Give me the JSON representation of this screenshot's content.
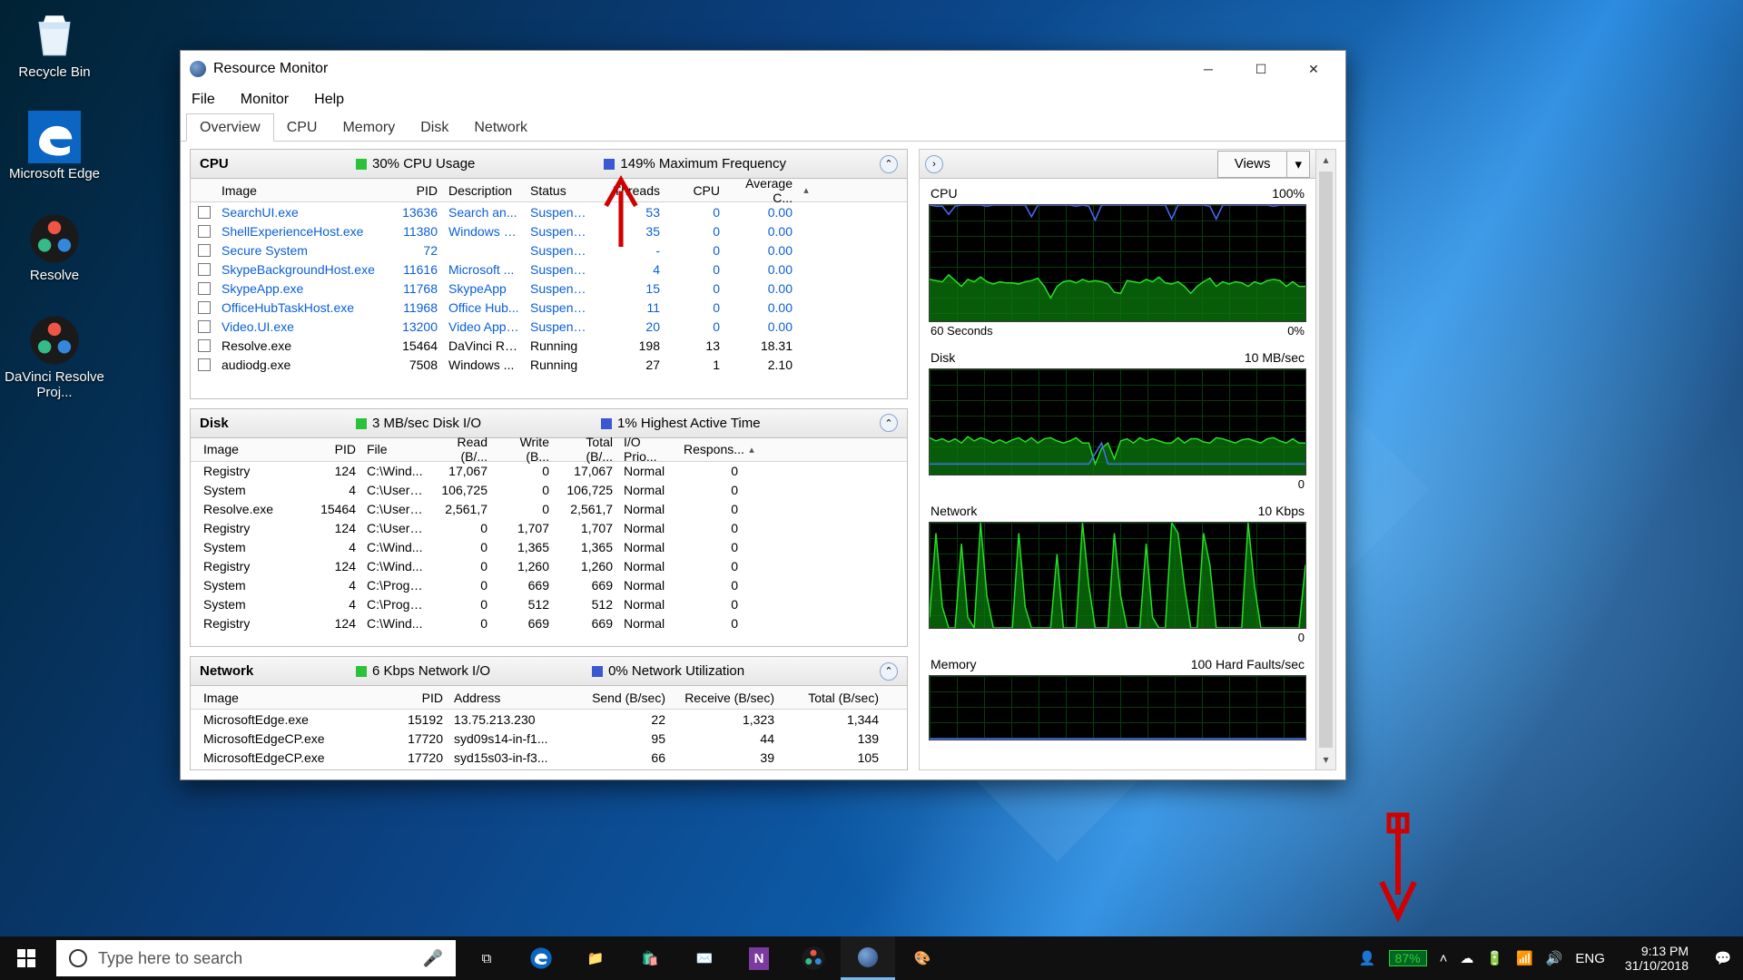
{
  "desktop": {
    "icons": [
      {
        "label": "Recycle Bin",
        "glyph": "recycle"
      },
      {
        "label": "Microsoft Edge",
        "glyph": "edge"
      },
      {
        "label": "Resolve",
        "glyph": "resolve"
      },
      {
        "label": "DaVinci Resolve Proj...",
        "glyph": "resolve"
      }
    ]
  },
  "window": {
    "title": "Resource Monitor",
    "menus": [
      "File",
      "Monitor",
      "Help"
    ],
    "tabs": [
      "Overview",
      "CPU",
      "Memory",
      "Disk",
      "Network"
    ],
    "active_tab": "Overview"
  },
  "cpu_panel": {
    "title": "CPU",
    "stat1": "30% CPU Usage",
    "stat2": "149% Maximum Frequency",
    "cols": [
      "Image",
      "PID",
      "Description",
      "Status",
      "Threads",
      "CPU",
      "Average C..."
    ],
    "rows": [
      {
        "img": "SearchUI.exe",
        "pid": "13636",
        "desc": "Search an...",
        "stat": "Suspended",
        "thr": "53",
        "cpu": "0",
        "avg": "0.00",
        "sus": true
      },
      {
        "img": "ShellExperienceHost.exe",
        "pid": "11380",
        "desc": "Windows S...",
        "stat": "Suspended",
        "thr": "35",
        "cpu": "0",
        "avg": "0.00",
        "sus": true
      },
      {
        "img": "Secure System",
        "pid": "72",
        "desc": "",
        "stat": "Suspended",
        "thr": "-",
        "cpu": "0",
        "avg": "0.00",
        "sus": true
      },
      {
        "img": "SkypeBackgroundHost.exe",
        "pid": "11616",
        "desc": "Microsoft ...",
        "stat": "Suspended",
        "thr": "4",
        "cpu": "0",
        "avg": "0.00",
        "sus": true
      },
      {
        "img": "SkypeApp.exe",
        "pid": "11768",
        "desc": "SkypeApp",
        "stat": "Suspended",
        "thr": "15",
        "cpu": "0",
        "avg": "0.00",
        "sus": true
      },
      {
        "img": "OfficeHubTaskHost.exe",
        "pid": "11968",
        "desc": "Office Hub...",
        "stat": "Suspended",
        "thr": "11",
        "cpu": "0",
        "avg": "0.00",
        "sus": true
      },
      {
        "img": "Video.UI.exe",
        "pid": "13200",
        "desc": "Video Appl...",
        "stat": "Suspended",
        "thr": "20",
        "cpu": "0",
        "avg": "0.00",
        "sus": true
      },
      {
        "img": "Resolve.exe",
        "pid": "15464",
        "desc": "DaVinci Re...",
        "stat": "Running",
        "thr": "198",
        "cpu": "13",
        "avg": "18.31",
        "sus": false
      },
      {
        "img": "audiodg.exe",
        "pid": "7508",
        "desc": "Windows ...",
        "stat": "Running",
        "thr": "27",
        "cpu": "1",
        "avg": "2.10",
        "sus": false
      }
    ]
  },
  "disk_panel": {
    "title": "Disk",
    "stat1": "3 MB/sec Disk I/O",
    "stat2": "1% Highest Active Time",
    "cols": [
      "Image",
      "PID",
      "File",
      "Read (B/...",
      "Write (B...",
      "Total (B/...",
      "I/O Prio...",
      "Respons..."
    ],
    "rows": [
      {
        "img": "Registry",
        "pid": "124",
        "file": "C:\\Wind...",
        "r": "17,067",
        "w": "0",
        "t": "17,067",
        "io": "Normal",
        "resp": "0"
      },
      {
        "img": "System",
        "pid": "4",
        "file": "C:\\Users...",
        "r": "106,725",
        "w": "0",
        "t": "106,725",
        "io": "Normal",
        "resp": "0"
      },
      {
        "img": "Resolve.exe",
        "pid": "15464",
        "file": "C:\\Users...",
        "r": "2,561,7",
        "w": "0",
        "t": "2,561,7",
        "io": "Normal",
        "resp": "0"
      },
      {
        "img": "Registry",
        "pid": "124",
        "file": "C:\\Users...",
        "r": "0",
        "w": "1,707",
        "t": "1,707",
        "io": "Normal",
        "resp": "0"
      },
      {
        "img": "System",
        "pid": "4",
        "file": "C:\\Wind...",
        "r": "0",
        "w": "1,365",
        "t": "1,365",
        "io": "Normal",
        "resp": "0"
      },
      {
        "img": "Registry",
        "pid": "124",
        "file": "C:\\Wind...",
        "r": "0",
        "w": "1,260",
        "t": "1,260",
        "io": "Normal",
        "resp": "0"
      },
      {
        "img": "System",
        "pid": "4",
        "file": "C:\\Progr...",
        "r": "0",
        "w": "669",
        "t": "669",
        "io": "Normal",
        "resp": "0"
      },
      {
        "img": "System",
        "pid": "4",
        "file": "C:\\Progr...",
        "r": "0",
        "w": "512",
        "t": "512",
        "io": "Normal",
        "resp": "0"
      },
      {
        "img": "Registry",
        "pid": "124",
        "file": "C:\\Wind...",
        "r": "0",
        "w": "669",
        "t": "669",
        "io": "Normal",
        "resp": "0"
      }
    ]
  },
  "net_panel": {
    "title": "Network",
    "stat1": "6 Kbps Network I/O",
    "stat2": "0% Network Utilization",
    "cols": [
      "Image",
      "PID",
      "Address",
      "Send (B/sec)",
      "Receive (B/sec)",
      "Total (B/sec)"
    ],
    "rows": [
      {
        "img": "MicrosoftEdge.exe",
        "pid": "15192",
        "addr": "13.75.213.230",
        "s": "22",
        "r": "1,323",
        "t": "1,344"
      },
      {
        "img": "MicrosoftEdgeCP.exe",
        "pid": "17720",
        "addr": "syd09s14-in-f1...",
        "s": "95",
        "r": "44",
        "t": "139"
      },
      {
        "img": "MicrosoftEdgeCP.exe",
        "pid": "17720",
        "addr": "syd15s03-in-f3...",
        "s": "66",
        "r": "39",
        "t": "105"
      }
    ]
  },
  "charts": {
    "views_label": "Views",
    "cpu": {
      "label": "CPU",
      "right": "100%",
      "bl": "60 Seconds",
      "br": "0%"
    },
    "disk": {
      "label": "Disk",
      "right": "10 MB/sec",
      "br": "0"
    },
    "net": {
      "label": "Network",
      "right": "10 Kbps",
      "br": "0"
    },
    "mem": {
      "label": "Memory",
      "right": "100 Hard Faults/sec"
    }
  },
  "chart_data": [
    {
      "type": "line",
      "title": "CPU",
      "ylim": [
        0,
        100
      ],
      "xrange_seconds": 60,
      "series": [
        {
          "name": "CPU Usage %",
          "values": [
            36,
            35,
            34,
            40,
            35,
            30,
            36,
            34,
            38,
            34,
            32,
            34,
            33,
            33,
            32,
            34,
            35,
            37,
            30,
            20,
            30,
            34,
            35,
            33,
            36,
            34,
            35,
            34,
            32,
            25,
            24,
            35,
            34,
            33,
            36,
            34,
            38,
            33,
            32,
            34,
            30,
            24,
            30,
            34,
            37,
            30,
            34,
            32,
            34,
            33,
            30,
            34,
            32,
            35,
            36,
            35,
            30,
            34,
            30,
            30
          ]
        },
        {
          "name": "Max Frequency %",
          "values": [
            100,
            99,
            99,
            92,
            99,
            100,
            100,
            100,
            100,
            99,
            100,
            100,
            100,
            100,
            100,
            100,
            90,
            100,
            100,
            100,
            100,
            100,
            100,
            99,
            100,
            99,
            87,
            100,
            100,
            100,
            100,
            100,
            100,
            100,
            100,
            100,
            100,
            100,
            88,
            100,
            100,
            100,
            100,
            100,
            99,
            88,
            100,
            100,
            100,
            100,
            100,
            100,
            100,
            100,
            99,
            100,
            100,
            100,
            100,
            100
          ]
        }
      ]
    },
    {
      "type": "line",
      "title": "Disk",
      "ylabel": "MB/sec",
      "ylim": [
        0,
        10
      ],
      "xrange_seconds": 60,
      "series": [
        {
          "name": "Disk I/O",
          "values": [
            3.5,
            3.2,
            3.4,
            3.1,
            3.4,
            3.0,
            3.6,
            3.2,
            3.5,
            3.3,
            3.0,
            3.3,
            3.0,
            3.3,
            3.5,
            3.1,
            3.5,
            3.0,
            3.4,
            3.5,
            3.2,
            3.0,
            3.2,
            3.5,
            3.0,
            3.0,
            1.0,
            2.5,
            3.0,
            1.5,
            3.2,
            3.4,
            3.0,
            3.5,
            3.2,
            3.4,
            3.2,
            3.0,
            3.0,
            3.5,
            3.0,
            3.4,
            3.4,
            3.1,
            3.0,
            3.5,
            3.4,
            3.2,
            3.0,
            3.3,
            3.4,
            3.2,
            3.0,
            3.4,
            3.5,
            3.2,
            3.0,
            3.4,
            3.0,
            3.0
          ]
        },
        {
          "name": "Highest Active Time %",
          "values": [
            1,
            1,
            1,
            1,
            1,
            1,
            1,
            1,
            1,
            1,
            1,
            1,
            1,
            1,
            1,
            1,
            1,
            1,
            1,
            1,
            1,
            1,
            1,
            1,
            1,
            1,
            2,
            3,
            1,
            1,
            1,
            1,
            1,
            1,
            1,
            1,
            1,
            1,
            1,
            1,
            1,
            1,
            1,
            1,
            1,
            1,
            1,
            1,
            1,
            1,
            1,
            1,
            1,
            1,
            1,
            1,
            1,
            1,
            1,
            1
          ]
        }
      ]
    },
    {
      "type": "line",
      "title": "Network",
      "ylabel": "Kbps",
      "ylim": [
        0,
        10
      ],
      "xrange_seconds": 60,
      "series": [
        {
          "name": "Network I/O",
          "values": [
            1,
            9,
            2,
            0,
            0,
            8,
            1,
            0,
            10,
            3,
            0,
            0,
            0,
            0,
            9,
            2,
            0,
            0,
            0,
            0,
            7,
            0,
            0,
            0,
            10,
            4,
            0,
            0,
            0,
            9,
            3,
            0,
            0,
            0,
            8,
            1,
            0,
            0,
            10,
            9,
            4,
            0,
            0,
            9,
            6,
            0,
            0,
            0,
            0,
            0,
            10,
            4,
            0,
            0,
            0,
            0,
            0,
            0,
            0,
            6
          ]
        }
      ]
    },
    {
      "type": "line",
      "title": "Memory",
      "ylabel": "Hard Faults/sec",
      "ylim": [
        0,
        100
      ],
      "xrange_seconds": 60,
      "series": [
        {
          "name": "Hard Faults",
          "values": [
            1,
            1,
            1,
            1,
            1,
            1,
            1,
            1,
            1,
            1,
            1,
            1,
            1,
            1,
            1,
            1,
            1,
            1,
            1,
            1,
            1,
            1,
            1,
            1,
            1,
            1,
            1,
            1,
            1,
            1,
            1,
            1,
            1,
            1,
            1,
            1,
            1,
            1,
            1,
            1,
            1,
            1,
            1,
            1,
            1,
            1,
            1,
            1,
            1,
            1,
            1,
            1,
            1,
            1,
            1,
            1,
            1,
            1,
            1,
            1
          ]
        }
      ]
    }
  ],
  "taskbar": {
    "search_placeholder": "Type here to search",
    "battery": "87%",
    "lang": "ENG",
    "time": "9:13 PM",
    "date": "31/10/2018"
  }
}
